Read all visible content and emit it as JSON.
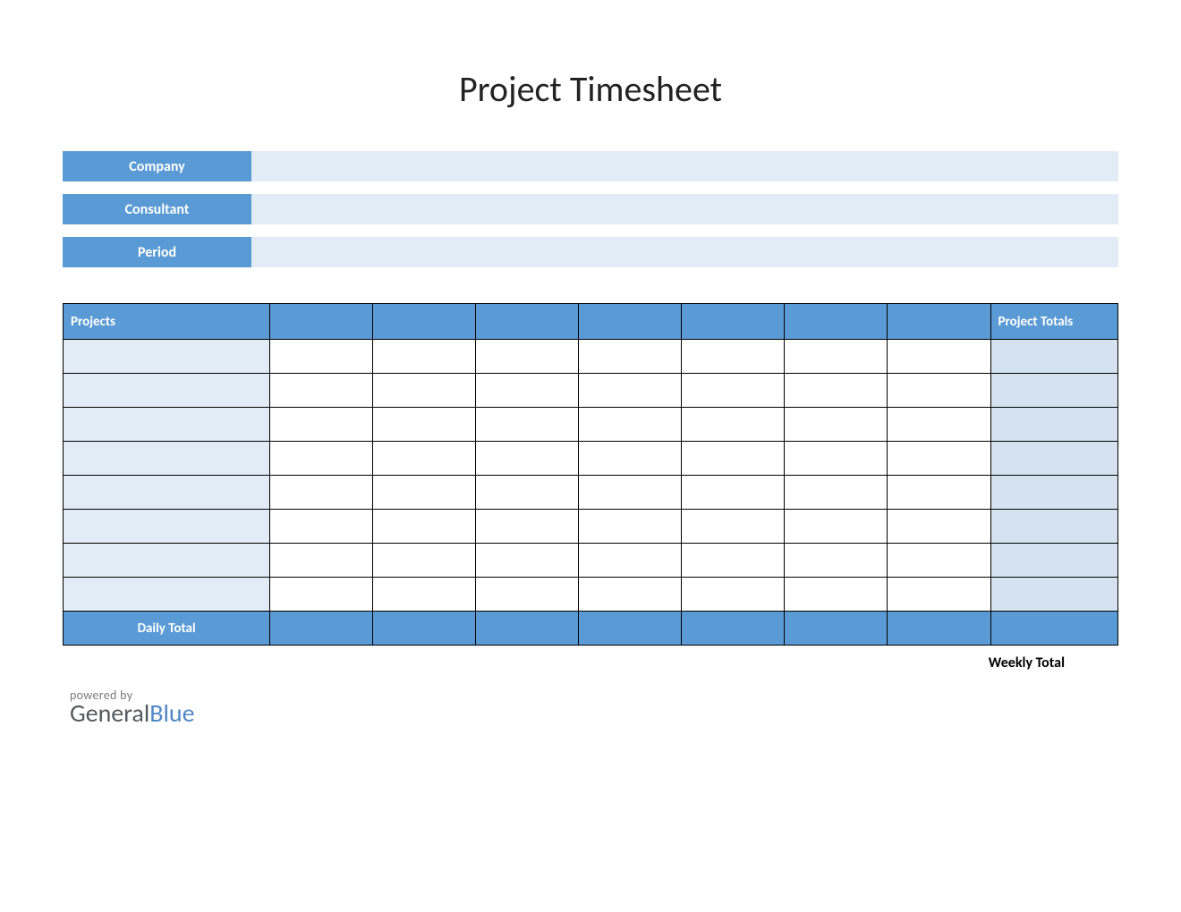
{
  "title": "Project Timesheet",
  "info": {
    "company_label": "Company",
    "company_value": "",
    "consultant_label": "Consultant",
    "consultant_value": "",
    "period_label": "Period",
    "period_value": ""
  },
  "table": {
    "headers": {
      "projects": "Projects",
      "day1": "",
      "day2": "",
      "day3": "",
      "day4": "",
      "day5": "",
      "day6": "",
      "day7": "",
      "totals": "Project Totals"
    },
    "rows": [
      {
        "project": "",
        "d1": "",
        "d2": "",
        "d3": "",
        "d4": "",
        "d5": "",
        "d6": "",
        "d7": "",
        "total": ""
      },
      {
        "project": "",
        "d1": "",
        "d2": "",
        "d3": "",
        "d4": "",
        "d5": "",
        "d6": "",
        "d7": "",
        "total": ""
      },
      {
        "project": "",
        "d1": "",
        "d2": "",
        "d3": "",
        "d4": "",
        "d5": "",
        "d6": "",
        "d7": "",
        "total": ""
      },
      {
        "project": "",
        "d1": "",
        "d2": "",
        "d3": "",
        "d4": "",
        "d5": "",
        "d6": "",
        "d7": "",
        "total": ""
      },
      {
        "project": "",
        "d1": "",
        "d2": "",
        "d3": "",
        "d4": "",
        "d5": "",
        "d6": "",
        "d7": "",
        "total": ""
      },
      {
        "project": "",
        "d1": "",
        "d2": "",
        "d3": "",
        "d4": "",
        "d5": "",
        "d6": "",
        "d7": "",
        "total": ""
      },
      {
        "project": "",
        "d1": "",
        "d2": "",
        "d3": "",
        "d4": "",
        "d5": "",
        "d6": "",
        "d7": "",
        "total": ""
      },
      {
        "project": "",
        "d1": "",
        "d2": "",
        "d3": "",
        "d4": "",
        "d5": "",
        "d6": "",
        "d7": "",
        "total": ""
      }
    ],
    "footer": {
      "label": "Daily Total",
      "d1": "",
      "d2": "",
      "d3": "",
      "d4": "",
      "d5": "",
      "d6": "",
      "d7": "",
      "total": ""
    }
  },
  "weekly_total_label": "Weekly Total",
  "brand": {
    "powered": "powered by",
    "part1": "General",
    "part2": "Blue"
  }
}
